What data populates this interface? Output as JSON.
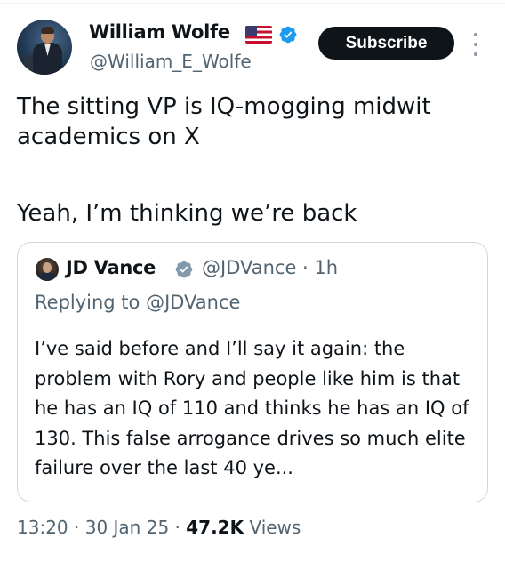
{
  "author": {
    "name": "William Wolfe",
    "handle": "@William_E_Wolfe",
    "flag": "us-flag-icon",
    "verified": true
  },
  "actions": {
    "subscribe_label": "Subscribe",
    "more_icon": "more-vertical-icon"
  },
  "tweet": {
    "text_line_1": "The sitting VP is IQ-mogging midwit\nacademics on X",
    "text_line_2": "Yeah, I’m thinking we’re back"
  },
  "quote": {
    "name": "JD Vance",
    "verified_badge": "gray-verified-icon",
    "handle_time": "@JDVance · 1h",
    "replying_to": "Replying to @JDVance",
    "text": "I’ve said before and I’ll say it again: the problem with Rory and people like him is that he has an IQ of 110 and thinks he has an IQ of 130.  This false arrogance drives so much elite failure over the last 40 ye..."
  },
  "meta": {
    "time": "13:20",
    "sep1": "·",
    "date": "30 Jan 25",
    "sep2": "·",
    "views_count": "47.2K",
    "views_label": "Views"
  },
  "colors": {
    "verified_blue": "#1d9bf0",
    "verified_gray": "#829aab",
    "secondary_text": "#536471",
    "primary_text": "#0f1419"
  }
}
